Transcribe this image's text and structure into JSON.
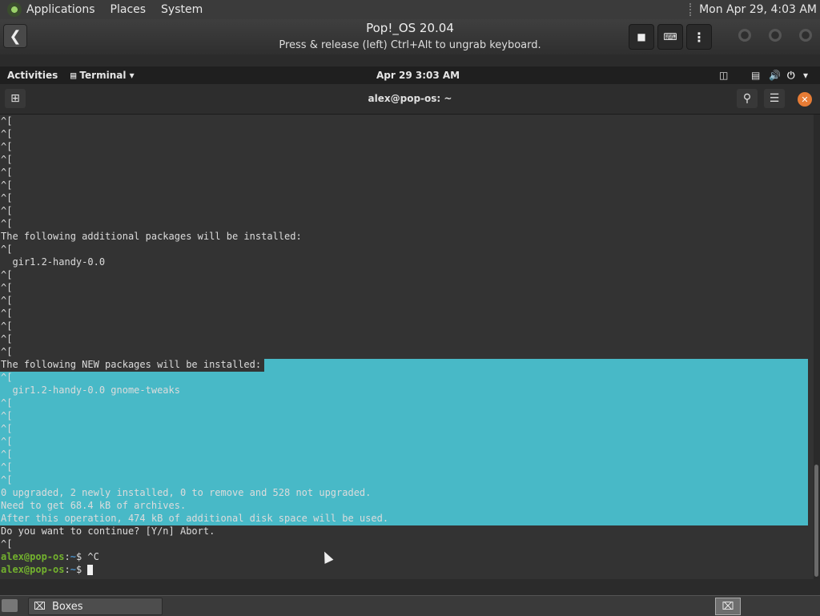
{
  "host_panel": {
    "menus": [
      "Applications",
      "Places",
      "System"
    ],
    "clock": "Mon Apr 29,  4:03 AM"
  },
  "boxes": {
    "title": "Pop!_OS 20.04",
    "subtitle": "Press & release (left) Ctrl+Alt to ungrab keyboard."
  },
  "guest": {
    "activities": "Activities",
    "app_menu": "Terminal",
    "clock": "Apr 29   3:03 AM"
  },
  "terminal": {
    "title": "alex@pop-os: ~",
    "prompt_user": "alex@pop-os",
    "prompt_path": "~",
    "lines": [
      "^[",
      "^[",
      "^[",
      "^[",
      "^[",
      "^[",
      "^[",
      "^[",
      "^[",
      "The following additional packages will be installed:",
      "^[",
      "  gir1.2-handy-0.0",
      "^[",
      "^[",
      "^[",
      "^[",
      "^[",
      "^[",
      "^[",
      "The following NEW packages will be installed:",
      "^[",
      "  gir1.2-handy-0.0 gnome-tweaks",
      "^[",
      "^[",
      "^[",
      "^[",
      "^[",
      "^[",
      "^[",
      "0 upgraded, 2 newly installed, 0 to remove and 528 not upgraded.",
      "Need to get 68.4 kB of archives.",
      "After this operation, 474 kB of additional disk space will be used.",
      "Do you want to continue? [Y/n] Abort.",
      "^["
    ],
    "prompt_cmd_1": "^C",
    "prompt_cmd_2": ""
  },
  "taskbar": {
    "task": "Boxes"
  }
}
